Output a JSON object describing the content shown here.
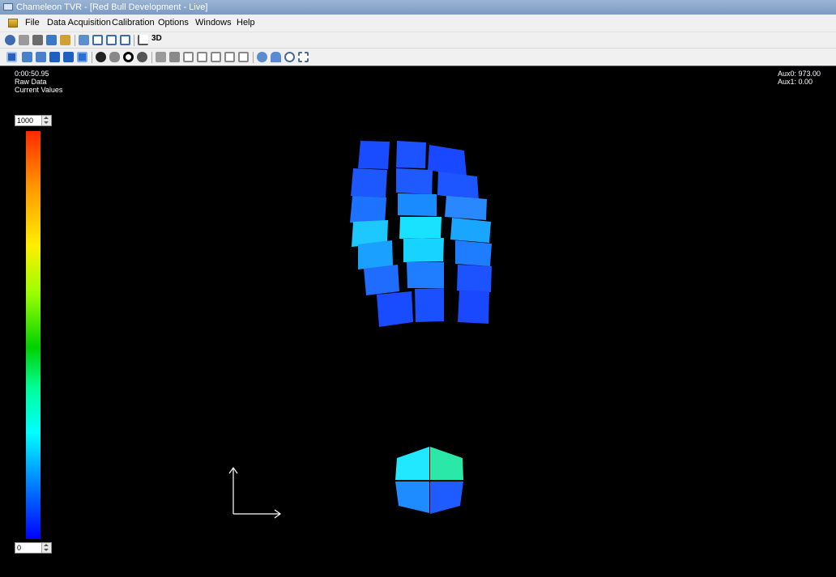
{
  "window": {
    "title": "Chameleon TVR - [Red Bull Development - Live]"
  },
  "menu": [
    "File",
    "Data Acquisition",
    "Calibration",
    "Options",
    "Windows",
    "Help"
  ],
  "toolbar1": {
    "icons": [
      "open-icon",
      "save-icon",
      "print-icon",
      "copy-icon",
      "export-icon",
      "cascade-windows-icon",
      "tile-vertical-icon",
      "tile-horizontal-icon",
      "list-icon",
      "chart-icon"
    ],
    "label_3d": "3D"
  },
  "toolbar2": {
    "icons": [
      "view-2d-icon",
      "bars-icon",
      "tilt-icon",
      "view-a-icon",
      "view-b-icon",
      "view-c-icon",
      "sphere-icon",
      "nodes-icon",
      "target-icon",
      "spot-icon",
      "cube-icon",
      "box-front-icon",
      "box-side-icon",
      "box-left-icon",
      "box-right-icon",
      "box-back-icon",
      "box-top-icon",
      "pan-icon",
      "rotate-icon",
      "zoom-icon",
      "zoom-window-icon"
    ]
  },
  "overlay": {
    "time": "0:00:50.95",
    "mode": "Raw Data",
    "values": "Current Values",
    "aux0": "Aux0: 973.00",
    "aux1": "Aux1: 0.00"
  },
  "scale": {
    "max": "1000",
    "min": "0"
  },
  "colors": {
    "accent_border": "#c62828",
    "background": "#000000"
  }
}
